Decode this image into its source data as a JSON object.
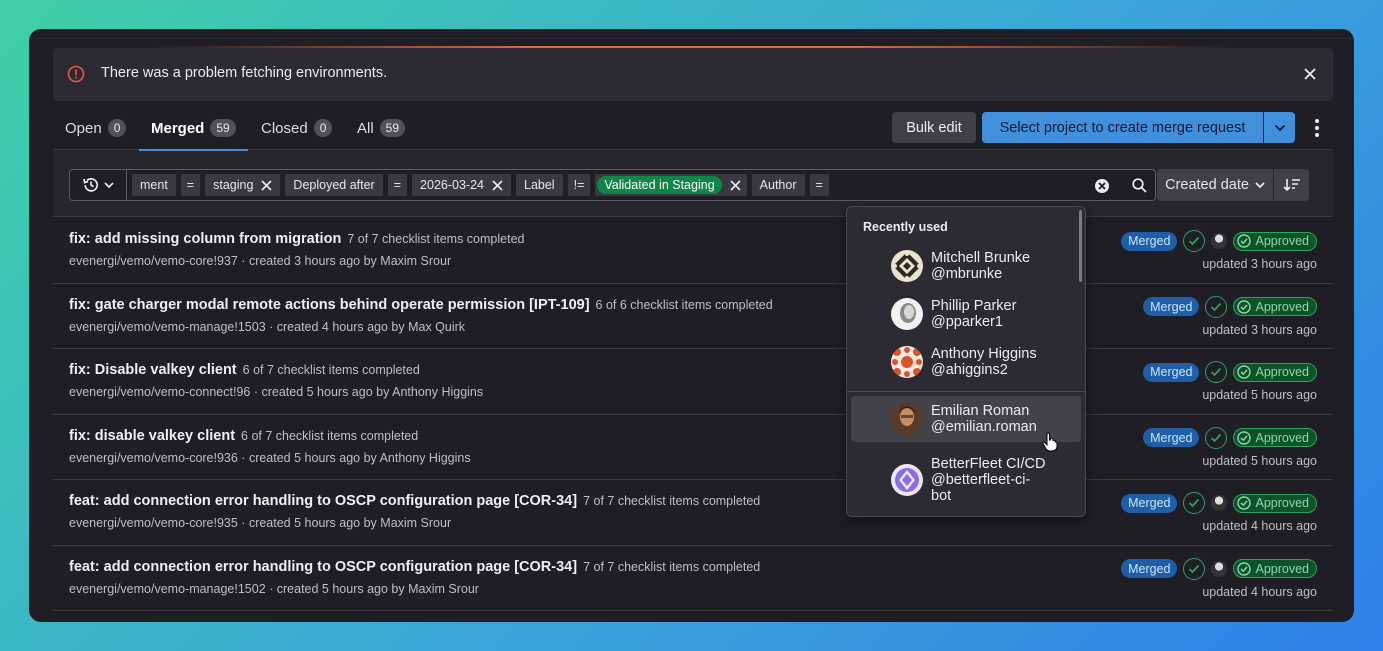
{
  "alert": {
    "message": "There was a problem fetching environments."
  },
  "tabs": [
    {
      "label": "Open",
      "count": "0"
    },
    {
      "label": "Merged",
      "count": "59"
    },
    {
      "label": "Closed",
      "count": "0"
    },
    {
      "label": "All",
      "count": "59"
    }
  ],
  "actions": {
    "bulk_edit": "Bulk edit",
    "create": "Select project to create merge request"
  },
  "filter": {
    "tokens": {
      "env_tail": "ment",
      "op1": "=",
      "env_val": "staging",
      "deployed": "Deployed after",
      "op2": "=",
      "date_val": "2026-03-24",
      "label": "Label",
      "op3": "!=",
      "label_val": "Validated in Staging",
      "author": "Author",
      "op4": "="
    },
    "sort_label": "Created date"
  },
  "dropdown": {
    "header": "Recently used",
    "users": [
      {
        "name": "Mitchell Brunke",
        "handle": "@mbrunke"
      },
      {
        "name": "Phillip Parker",
        "handle": "@pparker1"
      },
      {
        "name": "Anthony Higgins",
        "handle": "@ahiggins2"
      },
      {
        "name": "Emilian Roman",
        "handle": "@emilian.roman"
      },
      {
        "name": "BetterFleet CI/CD",
        "handle": "@betterfleet-ci-",
        "handle2": "bot"
      }
    ]
  },
  "merge_requests": [
    {
      "title": "fix: add missing column from migration",
      "checklist": "7 of 7 checklist items completed",
      "meta": "evenergi/vemo/vemo-core!937 · created 3 hours ago by Maxim Srour",
      "status": "Merged",
      "approved": "Approved",
      "updated": "updated 3 hours ago"
    },
    {
      "title": "fix: gate charger modal remote actions behind operate permission [IPT-109]",
      "checklist": "6 of 6 checklist items completed",
      "meta": "evenergi/vemo/vemo-manage!1503 · created 4 hours ago by Max Quirk",
      "status": "Merged",
      "approved": "Approved",
      "updated": "updated 3 hours ago"
    },
    {
      "title": "fix: Disable valkey client",
      "checklist": "6 of 7 checklist items completed",
      "meta": "evenergi/vemo/vemo-connect!96 · created 5 hours ago by Anthony Higgins",
      "status": "Merged",
      "approved": "Approved",
      "updated": "updated 5 hours ago"
    },
    {
      "title": "fix: disable valkey client",
      "checklist": "6 of 7 checklist items completed",
      "meta": "evenergi/vemo/vemo-core!936 · created 5 hours ago by Anthony Higgins",
      "status": "Merged",
      "approved": "Approved",
      "updated": "updated 5 hours ago"
    },
    {
      "title": "feat: add connection error handling to OSCP configuration page [COR-34]",
      "checklist": "7 of 7 checklist items completed",
      "meta": "evenergi/vemo/vemo-core!935 · created 5 hours ago by Maxim Srour",
      "status": "Merged",
      "approved": "Approved",
      "updated": "updated 4 hours ago"
    },
    {
      "title": "feat: add connection error handling to OSCP configuration page [COR-34]",
      "checklist": "7 of 7 checklist items completed",
      "meta": "evenergi/vemo/vemo-manage!1502 · created 5 hours ago by Maxim Srour",
      "status": "Merged",
      "approved": "Approved",
      "updated": "updated 4 hours ago"
    }
  ]
}
